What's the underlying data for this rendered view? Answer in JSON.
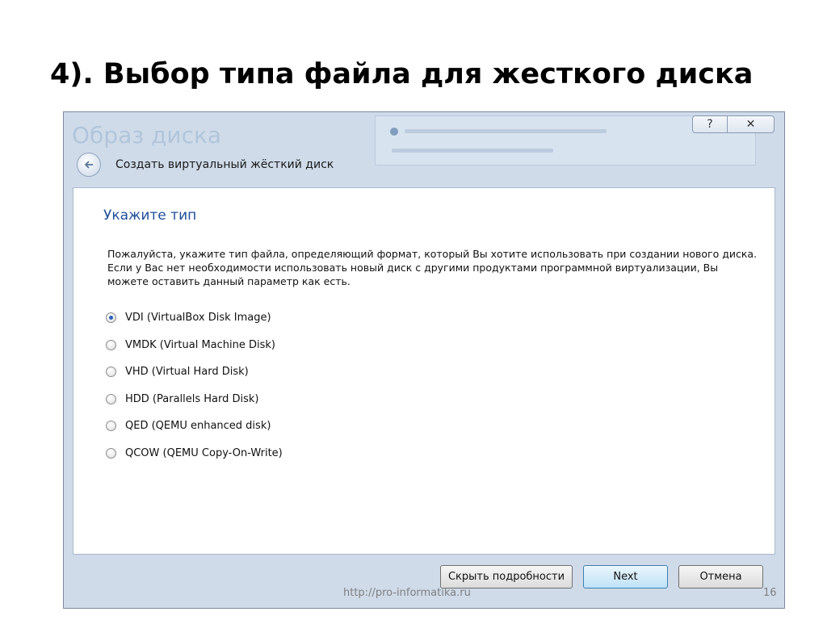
{
  "slide": {
    "title": "4). Выбор типа файла для жесткого диска",
    "footer_url": "http://pro-informatika.ru",
    "page_number": "16"
  },
  "dialog": {
    "ghost_title": "Образ диска",
    "help_button": "?",
    "close_button": "✕",
    "wizard_title": "Создать виртуальный жёсткий диск",
    "heading": "Укажите тип",
    "description": "Пожалуйста, укажите тип файла, определяющий формат, который Вы хотите использовать при создании нового диска. Если у Вас нет необходимости использовать новый диск с другими продуктами программной виртуализации, Вы можете оставить данный параметр как есть.",
    "options": [
      {
        "label": "VDI (VirtualBox Disk Image)",
        "checked": true
      },
      {
        "label": "VMDK (Virtual Machine Disk)",
        "checked": false
      },
      {
        "label": "VHD (Virtual Hard Disk)",
        "checked": false
      },
      {
        "label": "HDD (Parallels Hard Disk)",
        "checked": false
      },
      {
        "label": "QED (QEMU enhanced disk)",
        "checked": false
      },
      {
        "label": "QCOW (QEMU Copy-On-Write)",
        "checked": false
      }
    ],
    "buttons": {
      "hide_details": "Скрыть подробности",
      "next": "Next",
      "cancel": "Отмена"
    }
  }
}
